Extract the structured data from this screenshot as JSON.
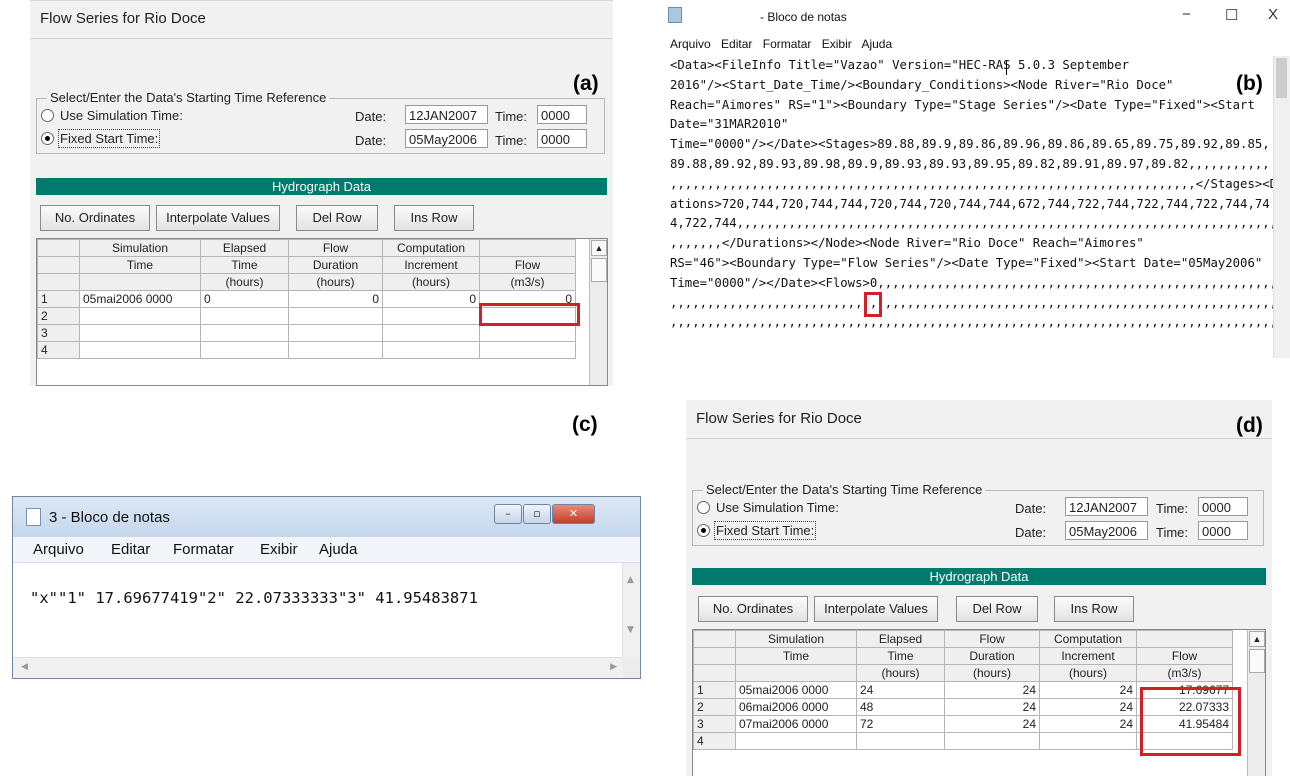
{
  "labels": {
    "a": "(a)",
    "b": "(b)",
    "c": "(c)",
    "d": "(d)"
  },
  "flow_editor": {
    "title": "Flow Series for Rio Doce",
    "group_title": "Select/Enter the Data's Starting Time Reference",
    "option_sim": "Use Simulation Time:",
    "option_fixed": "Fixed Start Time:",
    "date_label": "Date:",
    "time_label": "Time:",
    "sim_date": "12JAN2007",
    "sim_time": "0000",
    "fixed_date": "05May2006",
    "fixed_time": "0000",
    "hydrograph_header": "Hydrograph Data",
    "buttons": {
      "ordinates": "No. Ordinates",
      "interpolate": "Interpolate Values",
      "del_row": "Del Row",
      "ins_row": "Ins Row"
    },
    "columns": {
      "row1": [
        "Simulation",
        "Elapsed",
        "Flow",
        "Computation",
        ""
      ],
      "row2": [
        "Time",
        "Time",
        "Duration",
        "Increment",
        "Flow"
      ],
      "row3": [
        "",
        "(hours)",
        "(hours)",
        "(hours)",
        "(m3/s)"
      ]
    }
  },
  "panel_a": {
    "rows": [
      {
        "n": "1",
        "sim": "05mai2006 0000",
        "elapsed": "0",
        "dur": "0",
        "inc": "0",
        "flow": "0"
      },
      {
        "n": "2",
        "sim": "",
        "elapsed": "",
        "dur": "",
        "inc": "",
        "flow": ""
      },
      {
        "n": "3",
        "sim": "",
        "elapsed": "",
        "dur": "",
        "inc": "",
        "flow": ""
      },
      {
        "n": "4",
        "sim": "",
        "elapsed": "",
        "dur": "",
        "inc": "",
        "flow": ""
      }
    ]
  },
  "panel_d": {
    "rows": [
      {
        "n": "1",
        "sim": "05mai2006 0000",
        "elapsed": "24",
        "dur": "24",
        "inc": "24",
        "flow": "17.69677"
      },
      {
        "n": "2",
        "sim": "06mai2006 0000",
        "elapsed": "48",
        "dur": "24",
        "inc": "24",
        "flow": "22.07333"
      },
      {
        "n": "3",
        "sim": "07mai2006 0000",
        "elapsed": "72",
        "dur": "24",
        "inc": "24",
        "flow": "41.95484"
      },
      {
        "n": "4",
        "sim": "",
        "elapsed": "",
        "dur": "",
        "inc": "",
        "flow": ""
      }
    ]
  },
  "notepad_xml": {
    "title": "- Bloco de notas",
    "controls": {
      "min": "−",
      "max": "☐",
      "close": "X"
    },
    "menu": [
      "Arquivo",
      "Editar",
      "Formatar",
      "Exibir",
      "Ajuda"
    ],
    "lines": [
      "<Data><FileInfo Title=\"Vazao\" Version=\"HEC-RAS 5.0.3 September",
      "2016\"/><Start_Date_Time/><Boundary_Conditions><Node River=\"Rio Doce\"",
      "Reach=\"Aimores\" RS=\"1\"><Boundary Type=\"Stage Series\"/><Date Type=\"Fixed\"><Start",
      "Date=\"31MAR2010\"",
      "Time=\"0000\"/></Date><Stages>89.88,89.9,89.86,89.96,89.86,89.65,89.75,89.92,89.85,",
      "89.88,89.92,89.93,89.98,89.9,89.93,89.93,89.95,89.82,89.91,89.97,89.82,,,,,,,,,,,",
      ",,,,,,,,,,,,,,,,,,,,,,,,,,,,,,,,,,,,,,,,,,,,,,,,,,,,,,,,,,,,,,,,,,,,,,,</Stages><Dur",
      "ations>720,744,720,744,744,720,744,720,744,744,672,744,722,744,722,744,722,744,74",
      "4,722,744,,,,,,,,,,,,,,,,,,,,,,,,,,,,,,,,,,,,,,,,,,,,,,,,,,,,,,,,,,,,,,,,,,,,,,,,,",
      ",,,,,,,</Durations></Node><Node River=\"Rio Doce\" Reach=\"Aimores\"",
      "RS=\"46\"><Boundary Type=\"Flow Series\"/><Date Type=\"Fixed\"><Start Date=\"05May2006\"",
      "Time=\"0000\"/></Date><Flows>0,,,,,,,,,,,,,,,,,,,,,,,,,,,,,,,,,,,,,,,,,,,,,,,,,,,,,,,,,,,,,,",
      ",,,,,,,,,,,,,,,,,,,,,,,,,,,,,,,,,,,,,,,,,,,,,,,,,,,,,,,,,,,,,,,,,,,,,,,,,,,,,,,,,,,,",
      ",,,,,,,,,,,,,,,,,,,,,,,,,,,,,,,,,,,,,,,,,,,,,,,,,,,,,,,,,,,,,,,,,,,,,,,,,,,,,,,,,,,,"
    ]
  },
  "notepad_small": {
    "title": "3 - Bloco de notas",
    "menu": [
      "Arquivo",
      "Editar",
      "Formatar",
      "Exibir",
      "Ajuda"
    ],
    "content": "\"x\"\"1\" 17.69677419\"2\" 22.07333333\"3\" 41.95483871",
    "controls": {
      "min": "–",
      "max": "▫",
      "close": "✕"
    }
  },
  "colors": {
    "highlight": "#d0202c",
    "hydrograph_bar": "#007a6c"
  }
}
